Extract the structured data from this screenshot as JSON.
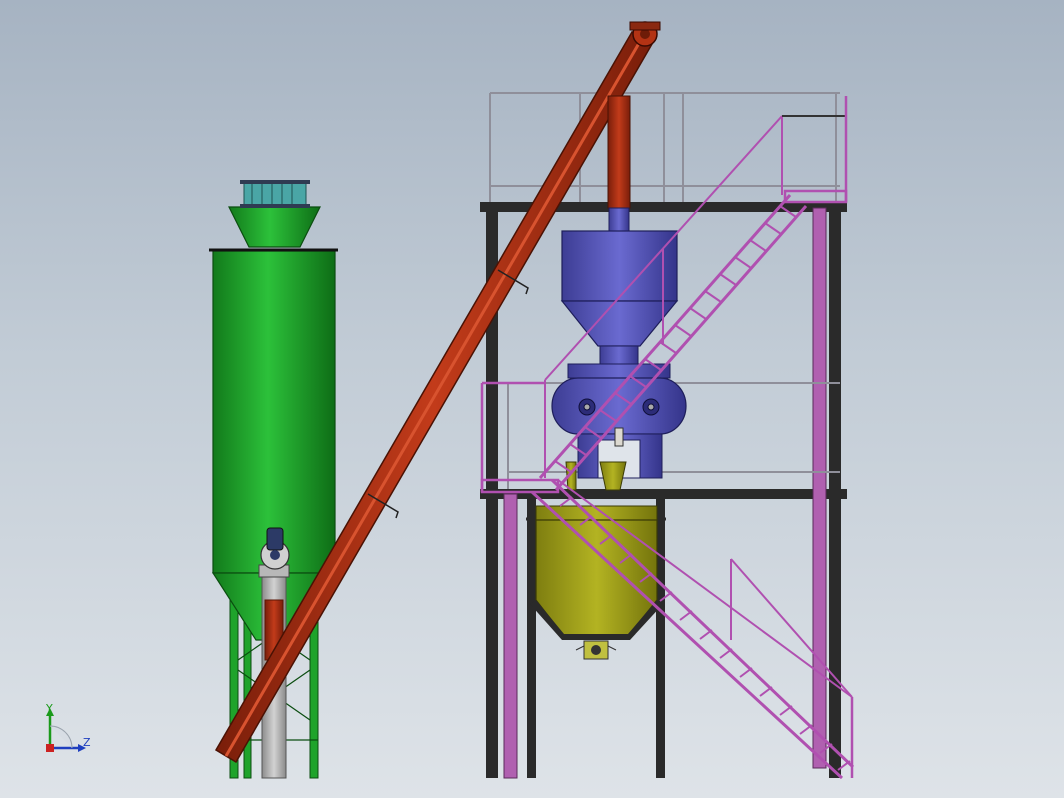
{
  "colors": {
    "silo": "#1fa32b",
    "silo_dark": "#0e6d16",
    "screw_conveyor": "#b33314",
    "screw_conveyor_dark": "#6e1c08",
    "mixer": "#5656b4",
    "mixer_dark": "#2c2c78",
    "weigh_hopper": "#a3a318",
    "weigh_hopper_dark": "#5d5d08",
    "stair": "#b050b0",
    "pillar": "#2a2a2a",
    "column": "#b060b0",
    "railing": "#8f8f9a",
    "motor": "#2c3a66"
  },
  "axis_indicator": {
    "y_label": "Y",
    "z_label": "Z",
    "y_color": "#1a9a1a",
    "z_color": "#1f3fbf"
  }
}
